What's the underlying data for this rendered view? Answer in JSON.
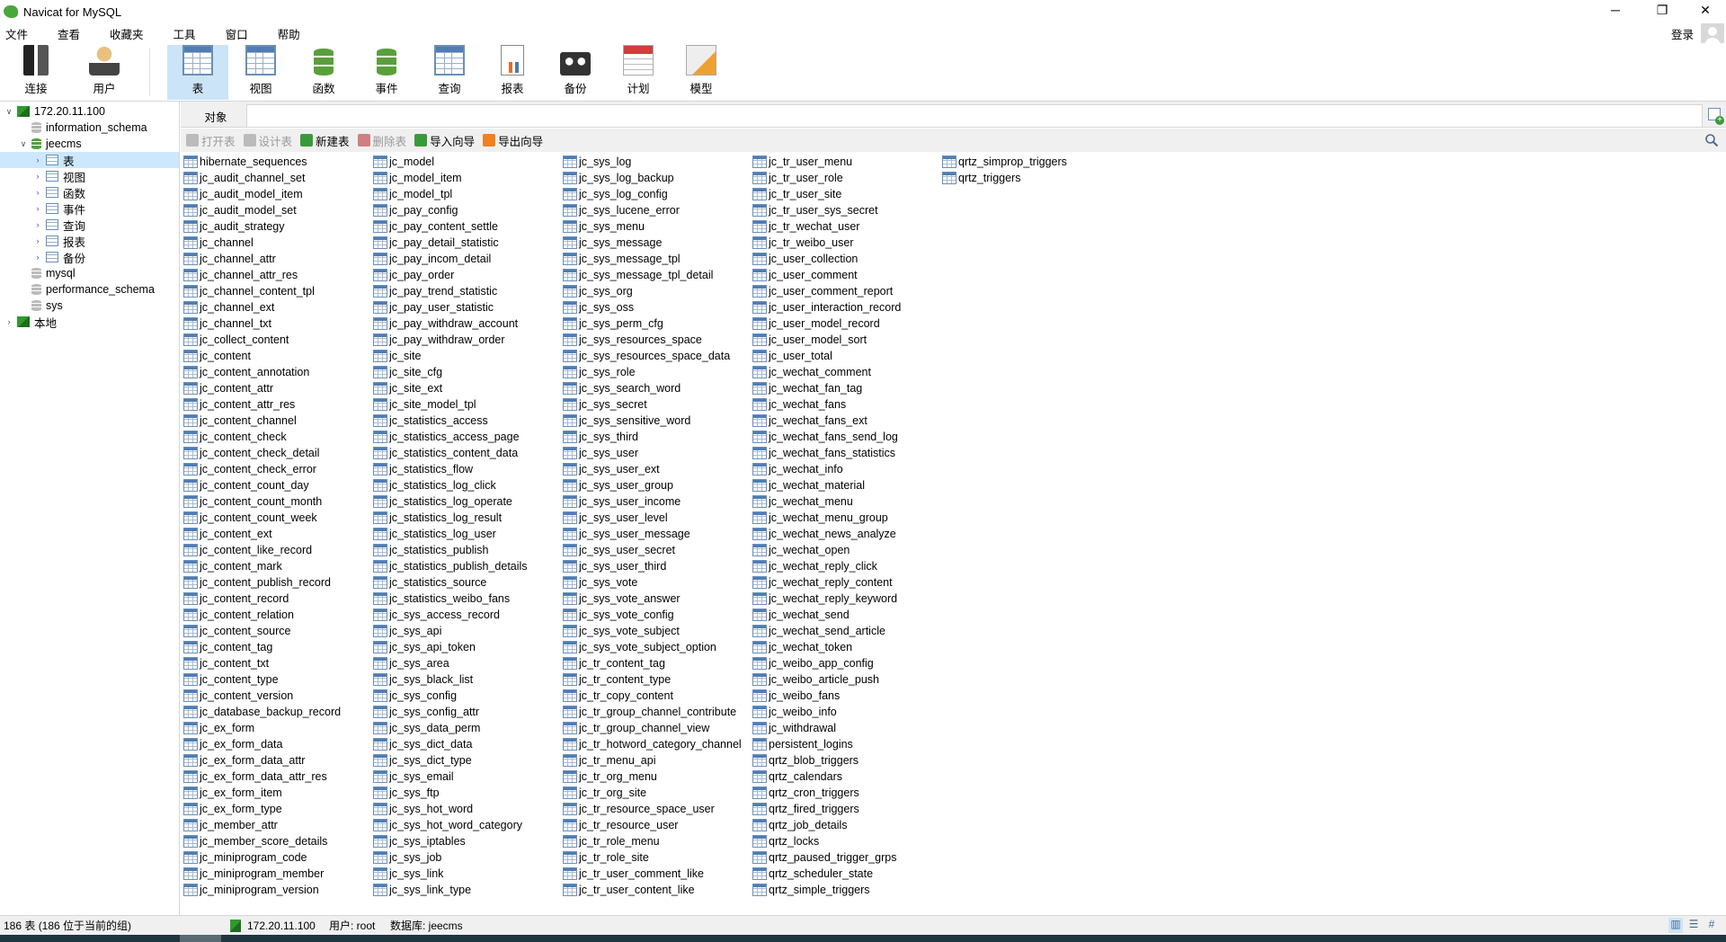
{
  "window": {
    "title": "Navicat for MySQL",
    "minimize": "─",
    "restore": "❐",
    "close": "✕"
  },
  "menu": [
    "文件",
    "查看",
    "收藏夹",
    "工具",
    "窗口",
    "帮助"
  ],
  "account": {
    "login": "登录"
  },
  "toolbar": [
    {
      "key": "connect",
      "label": "连接",
      "icon": "plug-icon"
    },
    {
      "key": "user",
      "label": "用户",
      "icon": "user-icon"
    },
    {
      "key": "table",
      "label": "表",
      "icon": "table-icon",
      "active": true
    },
    {
      "key": "view",
      "label": "视图",
      "icon": "view-icon"
    },
    {
      "key": "function",
      "label": "函数",
      "icon": "function-icon"
    },
    {
      "key": "event",
      "label": "事件",
      "icon": "event-icon"
    },
    {
      "key": "query",
      "label": "查询",
      "icon": "query-icon"
    },
    {
      "key": "report",
      "label": "报表",
      "icon": "report-icon"
    },
    {
      "key": "backup",
      "label": "备份",
      "icon": "backup-icon"
    },
    {
      "key": "schedule",
      "label": "计划",
      "icon": "calendar-icon"
    },
    {
      "key": "model",
      "label": "模型",
      "icon": "model-icon"
    }
  ],
  "tree": [
    {
      "label": "172.20.11.100",
      "level": 0,
      "twisty": "∨",
      "icon": "conn"
    },
    {
      "label": "information_schema",
      "level": 1,
      "twisty": "",
      "icon": "dbgray"
    },
    {
      "label": "jeecms",
      "level": 1,
      "twisty": "∨",
      "icon": "dbgreen"
    },
    {
      "label": "表",
      "level": 2,
      "twisty": "›",
      "icon": "table",
      "selected": true
    },
    {
      "label": "视图",
      "level": 2,
      "twisty": "›",
      "icon": "view"
    },
    {
      "label": "函数",
      "level": 2,
      "twisty": "›",
      "icon": "function"
    },
    {
      "label": "事件",
      "level": 2,
      "twisty": "›",
      "icon": "event"
    },
    {
      "label": "查询",
      "level": 2,
      "twisty": "›",
      "icon": "query"
    },
    {
      "label": "报表",
      "level": 2,
      "twisty": "›",
      "icon": "report"
    },
    {
      "label": "备份",
      "level": 2,
      "twisty": "›",
      "icon": "backup"
    },
    {
      "label": "mysql",
      "level": 1,
      "twisty": "",
      "icon": "dbgray"
    },
    {
      "label": "performance_schema",
      "level": 1,
      "twisty": "",
      "icon": "dbgray"
    },
    {
      "label": "sys",
      "level": 1,
      "twisty": "",
      "icon": "dbgray"
    },
    {
      "label": "本地",
      "level": 0,
      "twisty": "›",
      "icon": "conn"
    }
  ],
  "tab": {
    "label": "对象"
  },
  "actions": [
    {
      "label": "打开表",
      "disabled": true,
      "color": "#bbbbbb"
    },
    {
      "label": "设计表",
      "disabled": true,
      "color": "#bbbbbb"
    },
    {
      "label": "新建表",
      "disabled": false,
      "color": "#3a9a3a"
    },
    {
      "label": "删除表",
      "disabled": true,
      "color": "#d08080"
    },
    {
      "label": "导入向导",
      "disabled": false,
      "color": "#3a9a3a"
    },
    {
      "label": "导出向导",
      "disabled": false,
      "color": "#f08020"
    }
  ],
  "tables": [
    [
      "hibernate_sequences",
      "jc_audit_channel_set",
      "jc_audit_model_item",
      "jc_audit_model_set",
      "jc_audit_strategy",
      "jc_channel",
      "jc_channel_attr",
      "jc_channel_attr_res",
      "jc_channel_content_tpl",
      "jc_channel_ext",
      "jc_channel_txt",
      "jc_collect_content",
      "jc_content",
      "jc_content_annotation",
      "jc_content_attr",
      "jc_content_attr_res",
      "jc_content_channel",
      "jc_content_check",
      "jc_content_check_detail",
      "jc_content_check_error",
      "jc_content_count_day",
      "jc_content_count_month",
      "jc_content_count_week",
      "jc_content_ext",
      "jc_content_like_record",
      "jc_content_mark",
      "jc_content_publish_record",
      "jc_content_record",
      "jc_content_relation",
      "jc_content_source",
      "jc_content_tag",
      "jc_content_txt",
      "jc_content_type",
      "jc_content_version",
      "jc_database_backup_record",
      "jc_ex_form",
      "jc_ex_form_data",
      "jc_ex_form_data_attr",
      "jc_ex_form_data_attr_res",
      "jc_ex_form_item",
      "jc_ex_form_type",
      "jc_member_attr",
      "jc_member_score_details",
      "jc_miniprogram_code",
      "jc_miniprogram_member",
      "jc_miniprogram_version"
    ],
    [
      "jc_model",
      "jc_model_item",
      "jc_model_tpl",
      "jc_pay_config",
      "jc_pay_content_settle",
      "jc_pay_detail_statistic",
      "jc_pay_incom_detail",
      "jc_pay_order",
      "jc_pay_trend_statistic",
      "jc_pay_user_statistic",
      "jc_pay_withdraw_account",
      "jc_pay_withdraw_order",
      "jc_site",
      "jc_site_cfg",
      "jc_site_ext",
      "jc_site_model_tpl",
      "jc_statistics_access",
      "jc_statistics_access_page",
      "jc_statistics_content_data",
      "jc_statistics_flow",
      "jc_statistics_log_click",
      "jc_statistics_log_operate",
      "jc_statistics_log_result",
      "jc_statistics_log_user",
      "jc_statistics_publish",
      "jc_statistics_publish_details",
      "jc_statistics_source",
      "jc_statistics_weibo_fans",
      "jc_sys_access_record",
      "jc_sys_api",
      "jc_sys_api_token",
      "jc_sys_area",
      "jc_sys_black_list",
      "jc_sys_config",
      "jc_sys_config_attr",
      "jc_sys_data_perm",
      "jc_sys_dict_data",
      "jc_sys_dict_type",
      "jc_sys_email",
      "jc_sys_ftp",
      "jc_sys_hot_word",
      "jc_sys_hot_word_category",
      "jc_sys_iptables",
      "jc_sys_job",
      "jc_sys_link",
      "jc_sys_link_type"
    ],
    [
      "jc_sys_log",
      "jc_sys_log_backup",
      "jc_sys_log_config",
      "jc_sys_lucene_error",
      "jc_sys_menu",
      "jc_sys_message",
      "jc_sys_message_tpl",
      "jc_sys_message_tpl_detail",
      "jc_sys_org",
      "jc_sys_oss",
      "jc_sys_perm_cfg",
      "jc_sys_resources_space",
      "jc_sys_resources_space_data",
      "jc_sys_role",
      "jc_sys_search_word",
      "jc_sys_secret",
      "jc_sys_sensitive_word",
      "jc_sys_third",
      "jc_sys_user",
      "jc_sys_user_ext",
      "jc_sys_user_group",
      "jc_sys_user_income",
      "jc_sys_user_level",
      "jc_sys_user_message",
      "jc_sys_user_secret",
      "jc_sys_user_third",
      "jc_sys_vote",
      "jc_sys_vote_answer",
      "jc_sys_vote_config",
      "jc_sys_vote_subject",
      "jc_sys_vote_subject_option",
      "jc_tr_content_tag",
      "jc_tr_content_type",
      "jc_tr_copy_content",
      "jc_tr_group_channel_contribute",
      "jc_tr_group_channel_view",
      "jc_tr_hotword_category_channel",
      "jc_tr_menu_api",
      "jc_tr_org_menu",
      "jc_tr_org_site",
      "jc_tr_resource_space_user",
      "jc_tr_resource_user",
      "jc_tr_role_menu",
      "jc_tr_role_site",
      "jc_tr_user_comment_like",
      "jc_tr_user_content_like"
    ],
    [
      "jc_tr_user_menu",
      "jc_tr_user_role",
      "jc_tr_user_site",
      "jc_tr_user_sys_secret",
      "jc_tr_wechat_user",
      "jc_tr_weibo_user",
      "jc_user_collection",
      "jc_user_comment",
      "jc_user_comment_report",
      "jc_user_interaction_record",
      "jc_user_model_record",
      "jc_user_model_sort",
      "jc_user_total",
      "jc_wechat_comment",
      "jc_wechat_fan_tag",
      "jc_wechat_fans",
      "jc_wechat_fans_ext",
      "jc_wechat_fans_send_log",
      "jc_wechat_fans_statistics",
      "jc_wechat_info",
      "jc_wechat_material",
      "jc_wechat_menu",
      "jc_wechat_menu_group",
      "jc_wechat_news_analyze",
      "jc_wechat_open",
      "jc_wechat_reply_click",
      "jc_wechat_reply_content",
      "jc_wechat_reply_keyword",
      "jc_wechat_send",
      "jc_wechat_send_article",
      "jc_wechat_token",
      "jc_weibo_app_config",
      "jc_weibo_article_push",
      "jc_weibo_fans",
      "jc_weibo_info",
      "jc_withdrawal",
      "persistent_logins",
      "qrtz_blob_triggers",
      "qrtz_calendars",
      "qrtz_cron_triggers",
      "qrtz_fired_triggers",
      "qrtz_job_details",
      "qrtz_locks",
      "qrtz_paused_trigger_grps",
      "qrtz_scheduler_state",
      "qrtz_simple_triggers"
    ],
    [
      "qrtz_simprop_triggers",
      "qrtz_triggers"
    ]
  ],
  "status": {
    "count": "186 表 (186 位于当前的组)",
    "host": "172.20.11.100",
    "user": "用户: root",
    "database": "数据库: jeecms"
  }
}
